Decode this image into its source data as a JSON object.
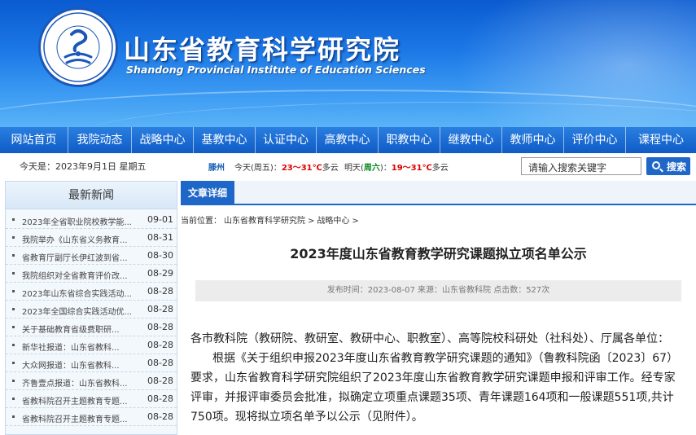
{
  "header": {
    "title_cn": "山东省教育科学研究院",
    "title_en": "Shandong Provincial Institute of Education Sciences"
  },
  "nav": {
    "items": [
      "网站首页",
      "我院动态",
      "战略中心",
      "基教中心",
      "认证中心",
      "高教中心",
      "职教中心",
      "继教中心",
      "教师中心",
      "评价中心",
      "课程中心"
    ]
  },
  "infobar": {
    "date": "今天是：2023年9月1日 星期五",
    "weather": {
      "city": "滕州",
      "today_label": "今天(周五)：",
      "today_temp": "23～31℃",
      "today_cond": "多云",
      "tomorrow_label": "明天(",
      "tomorrow_day": "周六",
      "tomorrow_label_end": ")：",
      "tomorrow_temp": "19～31℃",
      "tomorrow_cond": "多云"
    },
    "search_value": "请输入搜索关键字",
    "search_button": "搜索"
  },
  "sidebar": {
    "heading": "最新新闻",
    "news": [
      {
        "title": "2023年全省职业院校教学能...",
        "date": "09-01"
      },
      {
        "title": "我院举办《山东省义务教育...",
        "date": "08-31"
      },
      {
        "title": "省教育厅副厅长伊红波到省...",
        "date": "08-30"
      },
      {
        "title": "我院组织对全省教育评价改...",
        "date": "08-29"
      },
      {
        "title": "2023年山东省综合实践活动...",
        "date": "08-28"
      },
      {
        "title": "2023年全国综合实践活动优...",
        "date": "08-28"
      },
      {
        "title": "关于基础教育省级费职研...",
        "date": "08-28"
      },
      {
        "title": "新华社报道：山东省教科...",
        "date": "08-28"
      },
      {
        "title": "大众网报道：山东省教科...",
        "date": "08-28"
      },
      {
        "title": "齐鲁壹点报道：山东省教科...",
        "date": "08-28"
      },
      {
        "title": "省教科院召开主题教育专题...",
        "date": "08-28"
      },
      {
        "title": "省教科院召开主题教育专题...",
        "date": "08-28"
      }
    ]
  },
  "main": {
    "tab_label": "文章详细",
    "breadcrumb": [
      "当前位置：",
      "山东省教育科学研究院",
      ">",
      "战略中心",
      ">"
    ],
    "article_title": "2023年度山东省教育教学研究课题拟立项名单公示",
    "meta": "发布时间：2023-08-07 来源：山东省教科院 点击数：527次",
    "paragraphs": [
      "各市教科院（教研院、教研室、教研中心、职教室）、高等院校科研处（社科处）、厅属各单位：",
      "根据《关于组织申报2023年度山东省教育教学研究课题的通知》（鲁教科院函〔2023〕67）要求，山东省教育科学研究院组织了2023年度山东省教育教学研究课题申报和评审工作。经专家评审，并报评审委员会批准，拟确定立项重点课题35项、青年课题164项和一般课题551项,共计750项。现将拟立项名单予以公示（见附件）。"
    ]
  }
}
